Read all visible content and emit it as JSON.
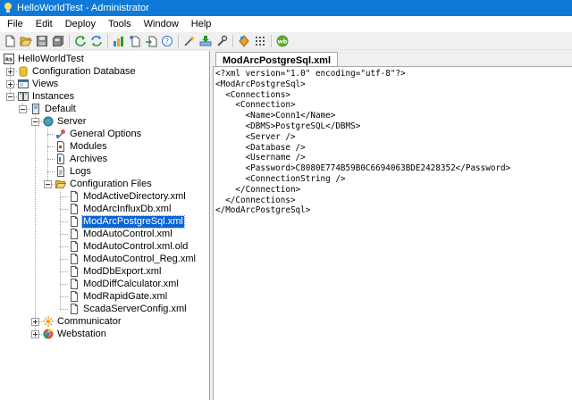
{
  "window": {
    "title": "HelloWorldTest - Administrator"
  },
  "menu": [
    {
      "label": "File"
    },
    {
      "label": "Edit"
    },
    {
      "label": "Deploy"
    },
    {
      "label": "Tools"
    },
    {
      "label": "Window"
    },
    {
      "label": "Help"
    }
  ],
  "toolbar": {
    "groups": [
      [
        "new-file-icon",
        "open-folder-icon",
        "save-icon",
        "save-all-icon"
      ],
      [
        "refresh-icon",
        "sync-icon"
      ],
      [
        "add-bar-chart-icon",
        "add-file-icon",
        "import-icon",
        "help-circle-icon"
      ],
      [
        "magic-wand-icon",
        "deploy-icon",
        "settings-wrench-icon"
      ],
      [
        "diamond-icon",
        "grid-icon"
      ],
      [
        "webstation-icon"
      ]
    ]
  },
  "tree": {
    "root": "HelloWorldTest",
    "configuration_database": "Configuration Database",
    "views": "Views",
    "instances": "Instances",
    "default": "Default",
    "server": "Server",
    "general_options": "General Options",
    "modules": "Modules",
    "archives": "Archives",
    "logs": "Logs",
    "configuration_files": "Configuration Files",
    "files": [
      "ModActiveDirectory.xml",
      "ModArcInfluxDb.xml",
      "ModArcPostgreSql.xml",
      "ModAutoControl.xml",
      "ModAutoControl.xml.old",
      "ModAutoControl_Reg.xml",
      "ModDbExport.xml",
      "ModDiffCalculator.xml",
      "ModRapidGate.xml",
      "ScadaServerConfig.xml"
    ],
    "selected_file": "ModArcPostgreSql.xml",
    "communicator": "Communicator",
    "webstation": "Webstation"
  },
  "editor": {
    "tab_label": "ModArcPostgreSql.xml",
    "lines": [
      "<?xml version=\"1.0\" encoding=\"utf-8\"?>",
      "<ModArcPostgreSql>",
      "  <Connections>",
      "    <Connection>",
      "      <Name>Conn1</Name>",
      "      <DBMS>PostgreSQL</DBMS>",
      "      <Server />",
      "      <Database />",
      "      <Username />",
      "      <Password>C8080E774B59B0C6694063BDE2428352</Password>",
      "      <ConnectionString />",
      "    </Connection>",
      "  </Connections>",
      "</ModArcPostgreSql>"
    ]
  },
  "colors": {
    "titlebar": "#0f79d8",
    "selection": "#0a64d2",
    "webstation_badge": "#5aa832"
  }
}
